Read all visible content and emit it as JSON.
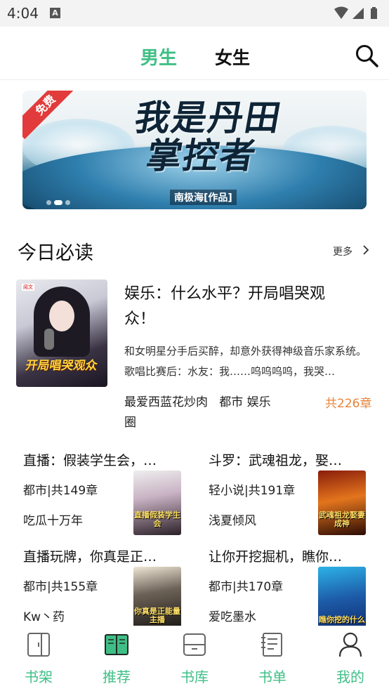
{
  "status_bar": {
    "time": "4:04",
    "notification_icon": "A"
  },
  "header": {
    "tabs": [
      {
        "label": "男生",
        "active": true
      },
      {
        "label": "女生",
        "active": false
      }
    ],
    "search_icon": "search-icon"
  },
  "banner": {
    "badge": "免费",
    "title": "我是丹田掌控者",
    "author": "南极海[作品]",
    "pages": 3,
    "active_page": 1
  },
  "section": {
    "title": "今日必读",
    "more_label": "更多"
  },
  "featured": {
    "title": "娱乐：什么水平？开局唱哭观众！",
    "description": "和女明星分手后买醉，却意外获得神级音乐家系统。歌唱比赛后：水友：我……呜呜呜呜，我哭…",
    "author": "最爱西蓝花炒肉",
    "tags": "都市  娱乐圈",
    "chapters": "共226章",
    "cover_title": "开局唱哭观众",
    "cover_subtitle": "娱乐：什么水平？"
  },
  "books": [
    {
      "title": "直播：假装学生会，…",
      "meta": "都市|共149章",
      "author": "吃瓜十万年",
      "cover_text": "直播假装学生会"
    },
    {
      "title": "斗罗：武魂祖龙，娶…",
      "meta": "轻小说|共191章",
      "author": "浅夏倾风",
      "cover_text": "武魂祖龙娶妻成神"
    },
    {
      "title": "直播玩牌，你真是正…",
      "meta": "都市|共155章",
      "author": "Kw丶药",
      "cover_text": "你真是正能量主播"
    },
    {
      "title": "让你开挖掘机，瞧你…",
      "meta": "都市|共170章",
      "author": "爱吃墨水",
      "cover_text": "瞧你挖的什么"
    }
  ],
  "bottom_nav": [
    {
      "label": "书架",
      "icon": "bookshelf-icon"
    },
    {
      "label": "推荐",
      "icon": "open-book-icon",
      "active": true
    },
    {
      "label": "书库",
      "icon": "library-icon"
    },
    {
      "label": "书单",
      "icon": "notebook-icon"
    },
    {
      "label": "我的",
      "icon": "profile-icon"
    }
  ],
  "colors": {
    "accent": "#3fbf86",
    "chapter_count": "#e8833a",
    "free_badge": "#e23b3b"
  }
}
